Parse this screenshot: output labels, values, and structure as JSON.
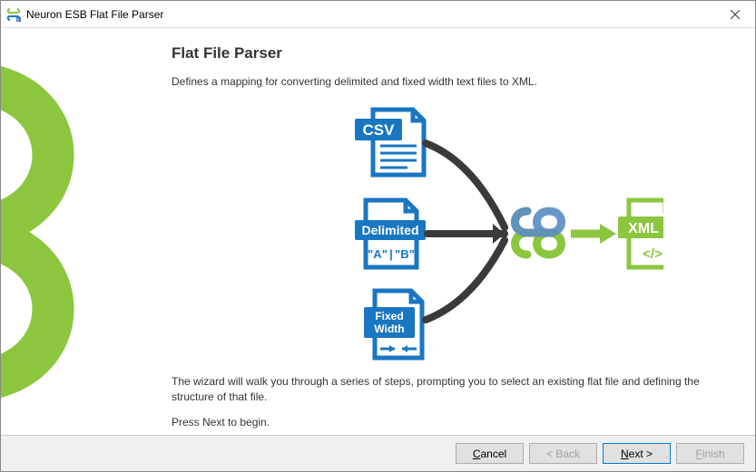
{
  "window": {
    "title": "Neuron ESB Flat File Parser"
  },
  "page": {
    "heading": "Flat File Parser",
    "intro": "Defines a mapping for converting delimited and fixed width text files to XML.",
    "description": "The wizard will walk you through a series of steps, prompting you to select an existing flat file and defining the structure of that file.",
    "begin": "Press Next to begin."
  },
  "diagram": {
    "inputs": {
      "csv": "CSV",
      "delimited": "Delimited",
      "delimited_sample_a": "\"A\"",
      "delimited_sample_pipe": "|",
      "delimited_sample_b": "\"B\"",
      "fixed_width_line1": "Fixed",
      "fixed_width_line2": "Width"
    },
    "output": {
      "xml": "XML",
      "xml_sample": "</>"
    }
  },
  "buttons": {
    "cancel": "Cancel",
    "back": "< Back",
    "next": "Next >",
    "finish": "Finish"
  },
  "button_states": {
    "back_enabled": false,
    "finish_enabled": false
  },
  "colors": {
    "blue": "#1976c1",
    "green": "#8cc63f"
  }
}
